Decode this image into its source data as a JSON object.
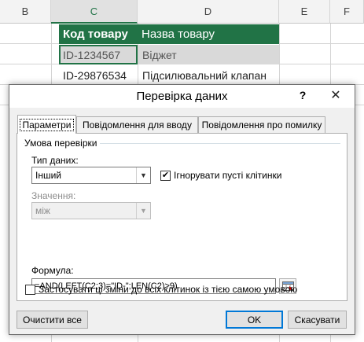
{
  "sheet": {
    "columns": [
      "B",
      "C",
      "D",
      "E",
      "F"
    ],
    "table": {
      "headers": [
        "Код товару",
        "Назва товару"
      ],
      "rows": [
        [
          "ID-1234567",
          "Віджет"
        ],
        [
          "ID-29876534",
          "Підсилювальний клапан"
        ]
      ]
    }
  },
  "dialog": {
    "title": "Перевірка даних",
    "help": "?",
    "close": "✕",
    "tabs": [
      "Параметри",
      "Повідомлення для вводу",
      "Повідомлення про помилку"
    ],
    "group_title": "Умова перевірки",
    "allow_label": "Тип даних:",
    "allow_value": "Інший",
    "ignore_blank_label": "Ігнорувати пусті клітинки",
    "ignore_blank_checked": true,
    "data_label": "Значення:",
    "data_value": "між",
    "formula_label": "Формула:",
    "formula_value": "=AND(LEFT(C2;3)=\"ID-\";LEN(C2)>9)",
    "apply_all_label": "Застосувати ці зміни до всіх клітинок із тією самою умовою",
    "apply_all_checked": false,
    "buttons": {
      "clear_all": "Очистити все",
      "ok": "OK",
      "cancel": "Скасувати"
    }
  }
}
